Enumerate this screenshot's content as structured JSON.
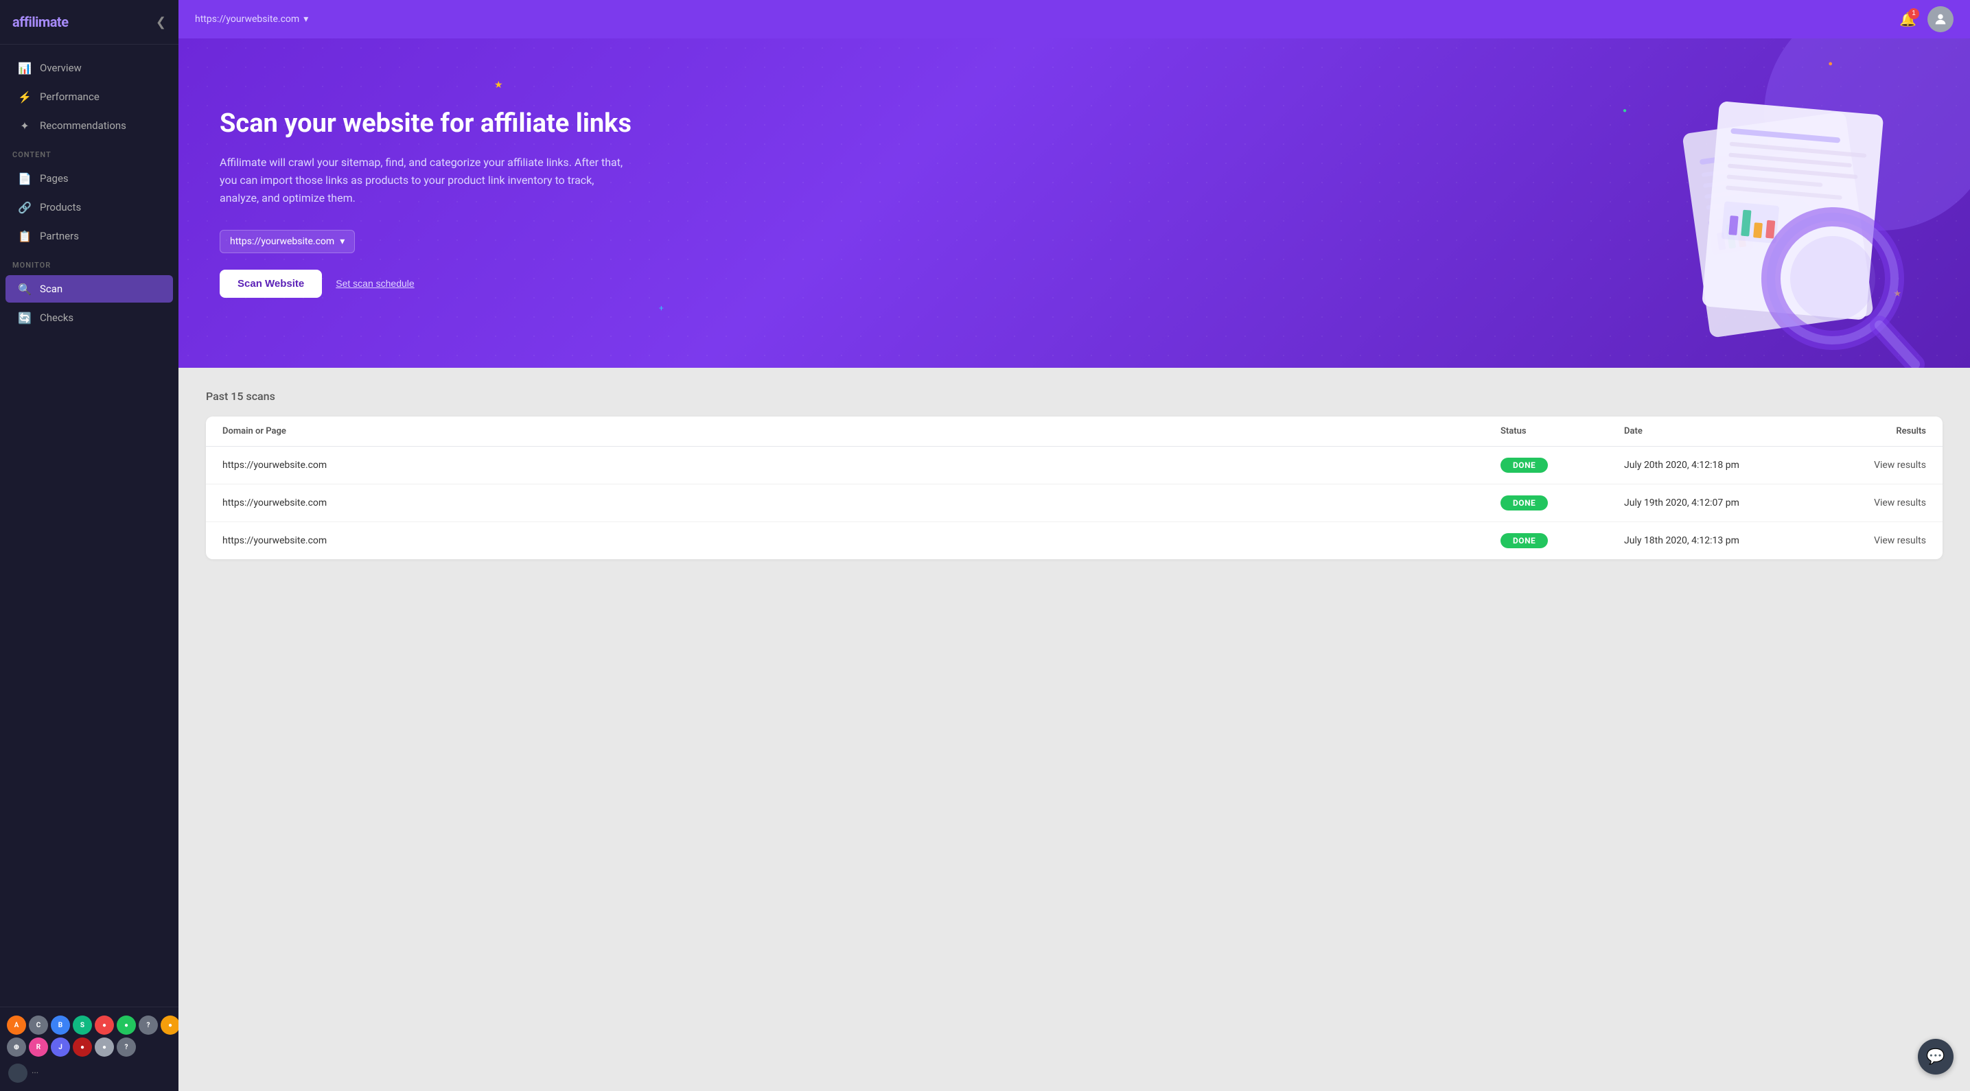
{
  "brand": {
    "name": "affilimate",
    "name_prefix": "affili",
    "name_suffix": "mate"
  },
  "topbar": {
    "url": "https://yourwebsite.com",
    "url_dropdown_label": "https://yourwebsite.com",
    "notification_count": "1"
  },
  "sidebar": {
    "collapse_icon": "❮",
    "nav_items": [
      {
        "id": "overview",
        "label": "Overview",
        "icon": "📊",
        "active": false
      },
      {
        "id": "performance",
        "label": "Performance",
        "icon": "⚡",
        "active": false
      },
      {
        "id": "recommendations",
        "label": "Recommendations",
        "icon": "✦",
        "active": false
      }
    ],
    "content_section_label": "CONTENT",
    "content_items": [
      {
        "id": "pages",
        "label": "Pages",
        "icon": "📄",
        "active": false
      },
      {
        "id": "products",
        "label": "Products",
        "icon": "🔗",
        "active": false
      },
      {
        "id": "partners",
        "label": "Partners",
        "icon": "📋",
        "active": false
      }
    ],
    "monitor_section_label": "MONITOR",
    "monitor_items": [
      {
        "id": "scan",
        "label": "Scan",
        "icon": "🔍",
        "active": true
      },
      {
        "id": "checks",
        "label": "Checks",
        "icon": "🔄",
        "active": false
      }
    ],
    "networks": [
      {
        "id": "amazon",
        "label": "A",
        "color": "#f97316"
      },
      {
        "id": "cj",
        "label": "C",
        "color": "#6b7280"
      },
      {
        "id": "bold",
        "label": "B",
        "color": "#3b82f6"
      },
      {
        "id": "shareasale",
        "label": "S",
        "color": "#10b981"
      },
      {
        "id": "red",
        "label": "●",
        "color": "#ef4444"
      },
      {
        "id": "green-circle",
        "label": "●",
        "color": "#22c55e"
      },
      {
        "id": "question1",
        "label": "?",
        "color": "#6b7280"
      },
      {
        "id": "orange2",
        "label": "●",
        "color": "#f59e0b"
      },
      {
        "id": "gray1",
        "label": "⊕",
        "color": "#6b7280"
      },
      {
        "id": "pink",
        "label": "R",
        "color": "#ec4899"
      },
      {
        "id": "blue2",
        "label": "J",
        "color": "#6366f1"
      },
      {
        "id": "dark-red",
        "label": "●",
        "color": "#b91c1c"
      },
      {
        "id": "gray2",
        "label": "●",
        "color": "#9ca3af"
      },
      {
        "id": "question2",
        "label": "?",
        "color": "#6b7280"
      },
      {
        "id": "more",
        "label": "···",
        "color": "#374151"
      }
    ]
  },
  "hero": {
    "title": "Scan your website for affiliate links",
    "description": "Affilimate will crawl your sitemap, find, and categorize your affiliate links. After that, you can import those links as products to your product link inventory to track, analyze, and optimize them.",
    "url_select_label": "https://yourwebsite.com",
    "scan_button_label": "Scan Website",
    "schedule_button_label": "Set scan schedule"
  },
  "scans": {
    "section_title": "Past 15 scans",
    "table_headers": {
      "domain": "Domain or Page",
      "status": "Status",
      "date": "Date",
      "results": "Results"
    },
    "rows": [
      {
        "domain": "https://yourwebsite.com",
        "status": "DONE",
        "date": "July 20th 2020, 4:12:18 pm",
        "results": "View results"
      },
      {
        "domain": "https://yourwebsite.com",
        "status": "DONE",
        "date": "July 19th 2020, 4:12:07 pm",
        "results": "View results"
      },
      {
        "domain": "https://yourwebsite.com",
        "status": "DONE",
        "date": "July 18th 2020, 4:12:13 pm",
        "results": "View results"
      }
    ]
  },
  "chat": {
    "icon": "💬"
  }
}
